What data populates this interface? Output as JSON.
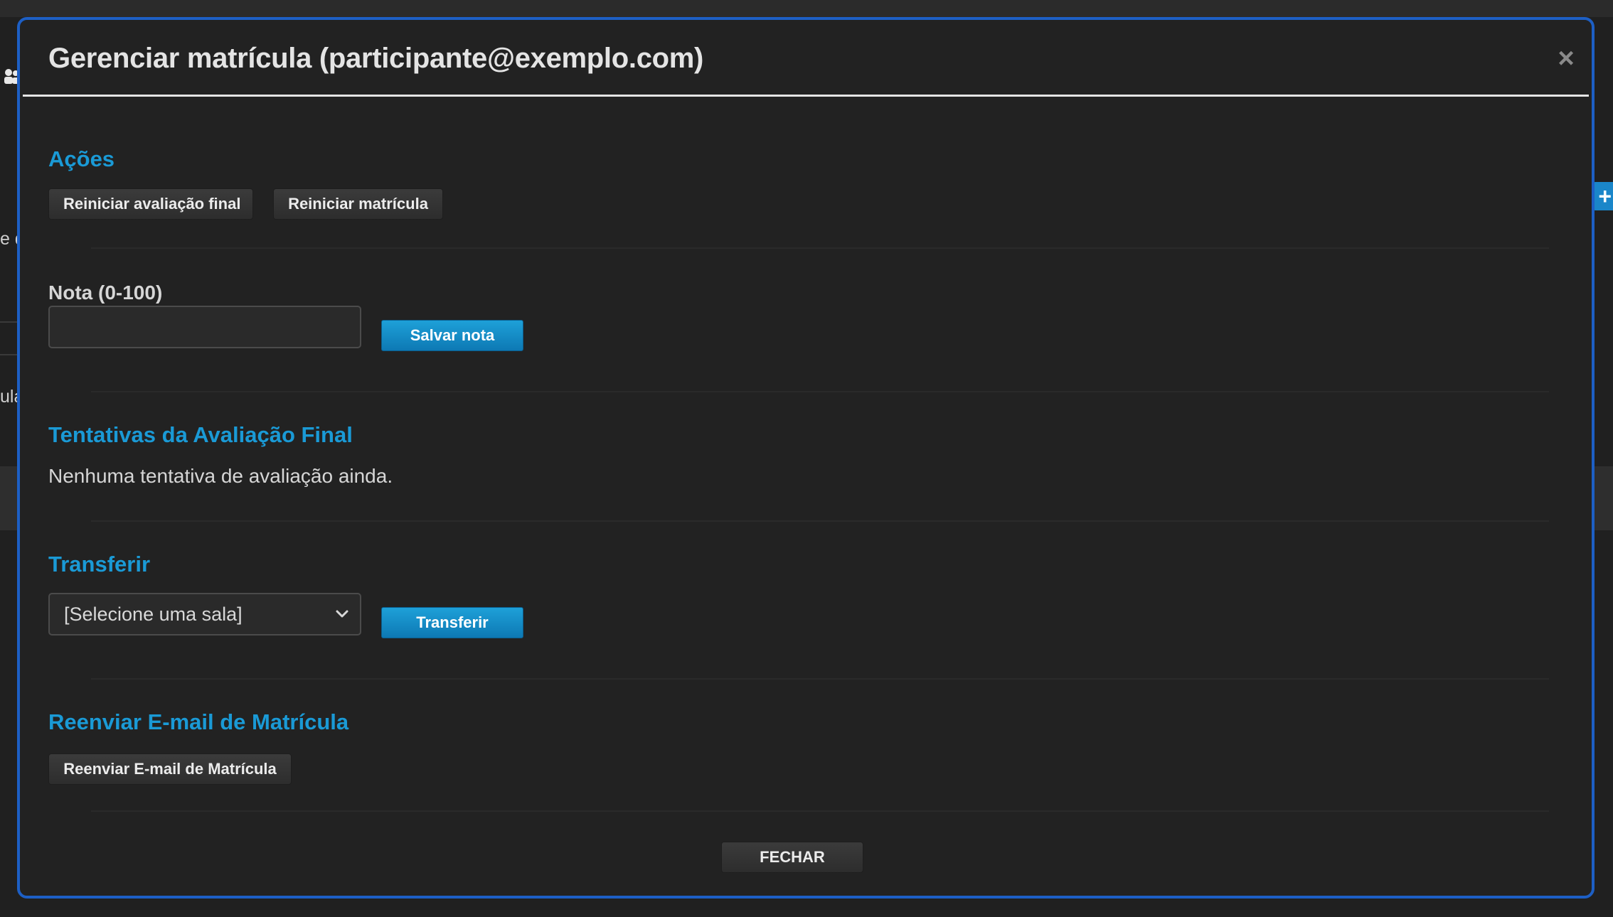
{
  "background": {
    "left_fragments": [
      "e d",
      "ulas"
    ],
    "right_button_label": "+"
  },
  "modal": {
    "title": "Gerenciar matrícula (participante@exemplo.com)",
    "close_label": "×",
    "accent_color": "#1a9ad6",
    "border_color": "#1d5fc5"
  },
  "actions": {
    "title": "Ações",
    "reset_final_label": "Reiniciar avaliação final",
    "reset_enrollment_label": "Reiniciar matrícula"
  },
  "grade": {
    "label": "Nota (0-100)",
    "value": "",
    "save_label": "Salvar nota"
  },
  "attempts": {
    "title": "Tentativas da Avaliação Final",
    "empty_message": "Nenhuma tentativa de avaliação ainda."
  },
  "transfer": {
    "title": "Transferir",
    "selected_option": "[Selecione uma sala]",
    "button_label": "Transferir"
  },
  "resend": {
    "title": "Reenviar E-mail de Matrícula",
    "button_label": "Reenviar E-mail de Matrícula"
  },
  "footer": {
    "close_label": "FECHAR"
  }
}
